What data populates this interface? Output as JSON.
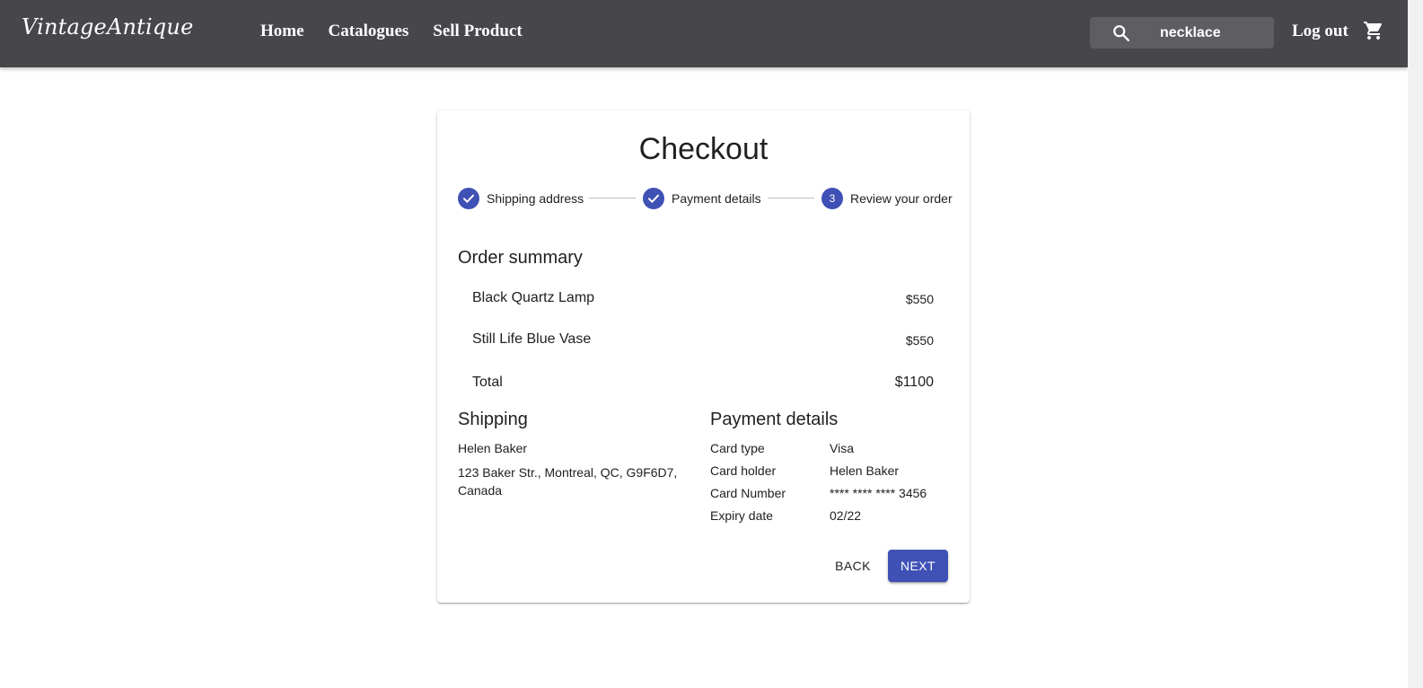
{
  "header": {
    "logo": "VintageAntique",
    "nav": [
      "Home",
      "Catalogues",
      "Sell Product"
    ],
    "search_value": "necklace",
    "logout_label": "Log out",
    "search_icon": "search-icon",
    "cart_icon": "shopping-cart-icon"
  },
  "checkout": {
    "title": "Checkout",
    "steps": [
      {
        "label": "Shipping address",
        "status": "completed",
        "icon": "check-icon"
      },
      {
        "label": "Payment details",
        "status": "completed",
        "icon": "check-icon"
      },
      {
        "label": "Review your order",
        "status": "active",
        "number": "3"
      }
    ],
    "order_summary": {
      "title": "Order summary",
      "items": [
        {
          "name": "Black Quartz Lamp",
          "price": "$550"
        },
        {
          "name": "Still Life Blue Vase",
          "price": "$550"
        }
      ],
      "total_label": "Total",
      "total_value": "$1100"
    },
    "shipping": {
      "title": "Shipping",
      "name": "Helen Baker",
      "address": "123 Baker Str., Montreal, QC, G9F6D7, Canada"
    },
    "payment": {
      "title": "Payment details",
      "rows": [
        {
          "label": "Card type",
          "value": "Visa"
        },
        {
          "label": "Card holder",
          "value": "Helen Baker"
        },
        {
          "label": "Card Number",
          "value": "**** **** **** 3456"
        },
        {
          "label": "Expiry date",
          "value": "02/22"
        }
      ]
    },
    "buttons": {
      "back": "BACK",
      "next": "NEXT"
    }
  },
  "colors": {
    "appbar": "#47464b",
    "search_bg": "#5e5d62",
    "primary": "#3f51b5"
  }
}
